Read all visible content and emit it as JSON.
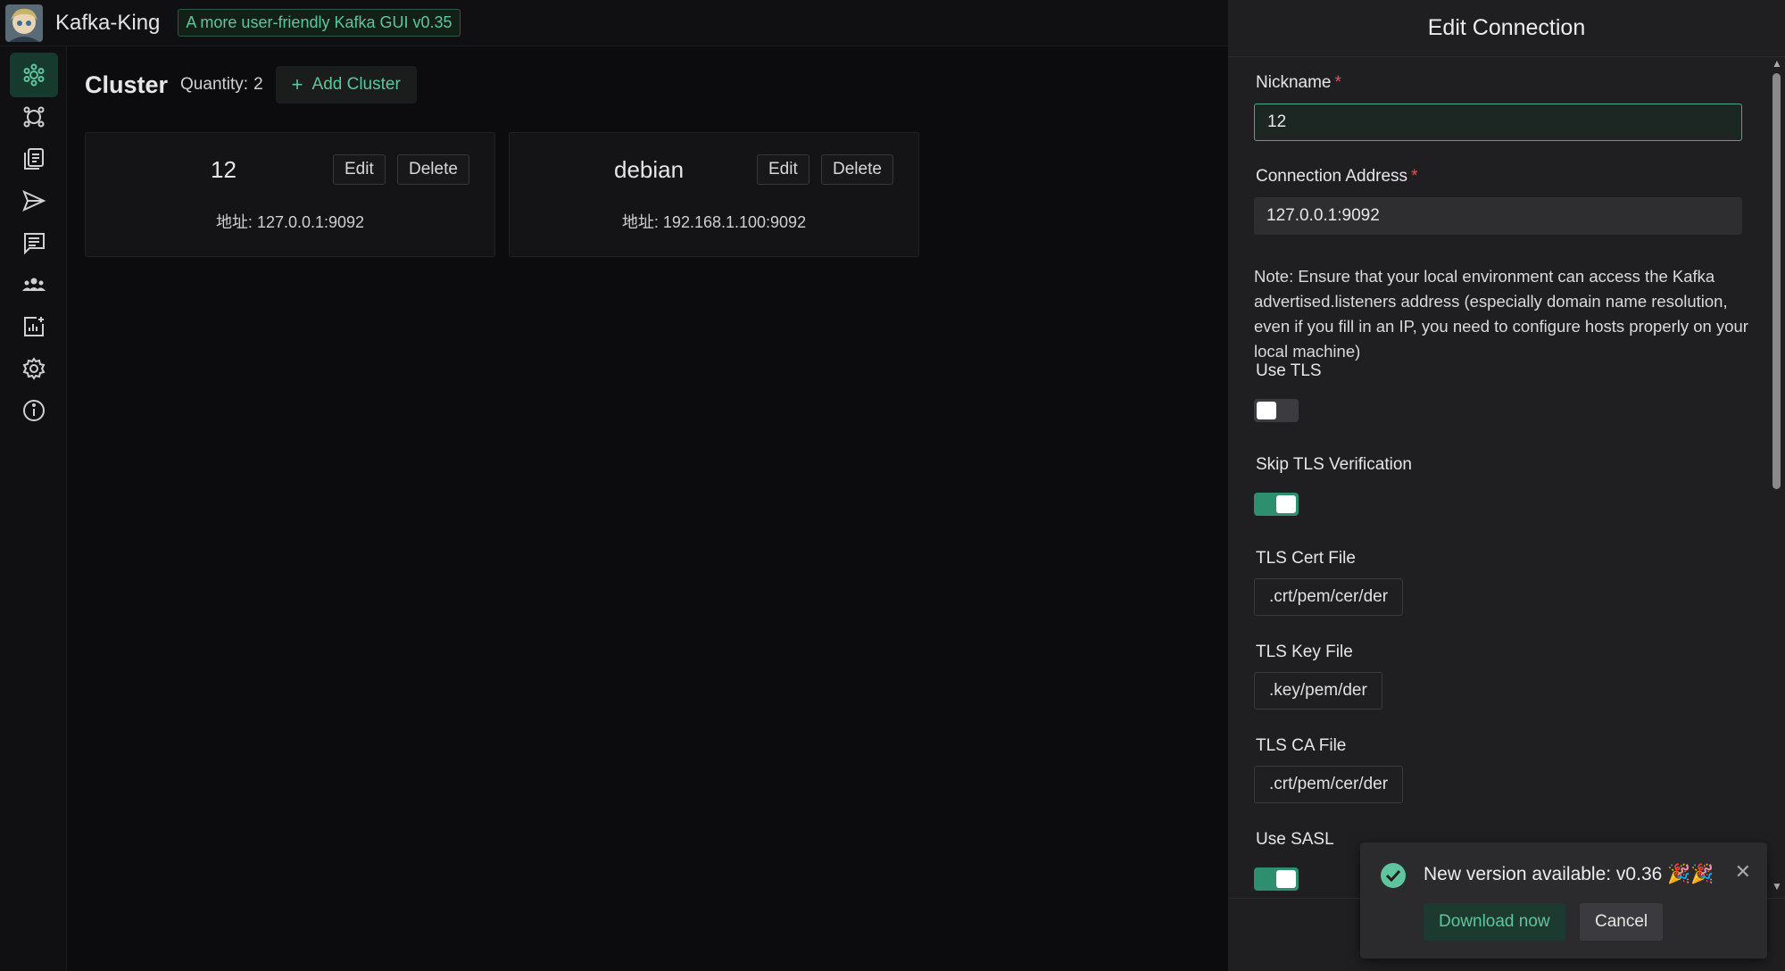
{
  "header": {
    "app_title": "Kafka-King",
    "version_tag": "A more user-friendly Kafka GUI v0.35"
  },
  "sidebar": {
    "items": [
      {
        "icon": "cluster-icon",
        "active": true
      },
      {
        "icon": "node-icon"
      },
      {
        "icon": "topic-list-icon"
      },
      {
        "icon": "send-icon"
      },
      {
        "icon": "message-icon"
      },
      {
        "icon": "group-icon"
      },
      {
        "icon": "monitor-chart-icon"
      },
      {
        "icon": "settings-gear-icon"
      },
      {
        "icon": "info-icon"
      }
    ]
  },
  "main": {
    "title": "Cluster",
    "quantity_label": "Quantity:",
    "quantity_value": "2",
    "add_button": "Add Cluster",
    "clusters": [
      {
        "name": "12",
        "edit": "Edit",
        "delete": "Delete",
        "address": "地址: 127.0.0.1:9092"
      },
      {
        "name": "debian",
        "edit": "Edit",
        "delete": "Delete",
        "address": "地址: 192.168.1.100:9092"
      }
    ]
  },
  "drawer": {
    "title": "Edit Connection",
    "nickname_label": "Nickname",
    "nickname_value": "12",
    "address_label": "Connection Address",
    "address_value": "127.0.0.1:9092",
    "required_mark": "*",
    "note": "Note: Ensure that your local environment can access the Kafka advertised.listeners address (especially domain name resolution, even if you fill in an IP, you need to configure hosts properly on your local machine)",
    "use_tls_label": "Use TLS",
    "use_tls": false,
    "skip_tls_label": "Skip TLS Verification",
    "skip_tls": true,
    "tls_cert_label": "TLS Cert File",
    "tls_cert_placeholder": ".crt/pem/cer/der",
    "tls_key_label": "TLS Key File",
    "tls_key_placeholder": ".key/pem/der",
    "tls_ca_label": "TLS CA File",
    "tls_ca_placeholder": ".crt/pem/cer/der",
    "use_sasl_label": "Use SASL",
    "use_sasl": true
  },
  "notification": {
    "message": "New version available: v0.36 🎉🎉",
    "download": "Download now",
    "cancel": "Cancel"
  },
  "colors": {
    "accent": "#5fc59e",
    "switch_on": "#2e8f6f",
    "required": "#e05454"
  }
}
